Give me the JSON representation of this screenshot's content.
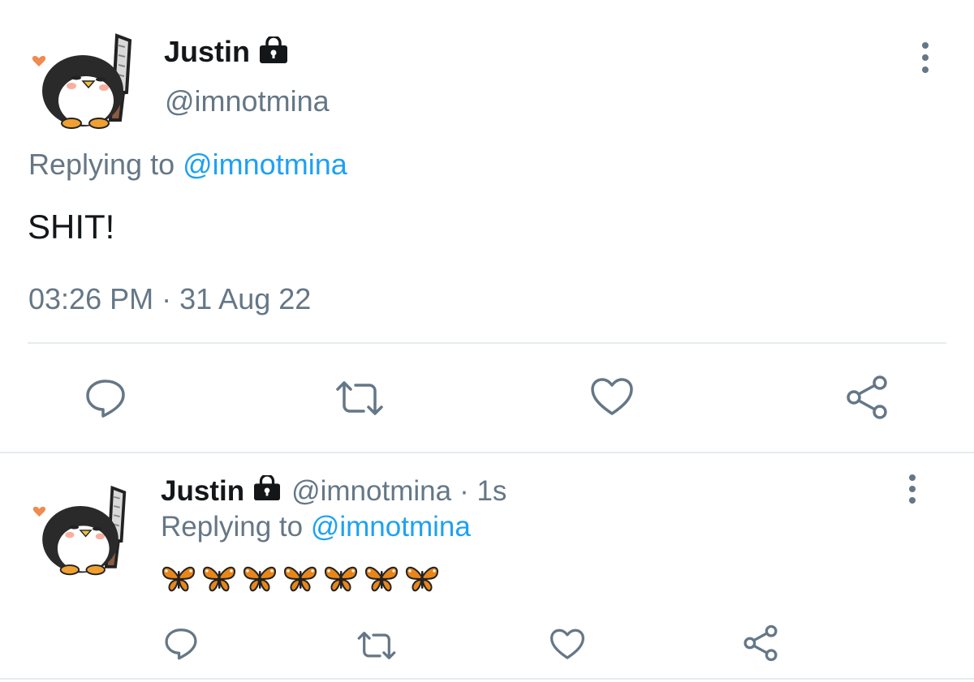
{
  "main_tweet": {
    "display_name": "Justin",
    "handle": "@imnotmina",
    "replying_prefix": "Replying to",
    "replying_to": "@imnotmina",
    "text": "SHIT!",
    "time": "03:26 PM",
    "separator": "·",
    "date": "31 Aug 22",
    "actions": [
      "reply-icon",
      "retweet-icon",
      "like-icon",
      "share-icon"
    ]
  },
  "reply_tweet": {
    "display_name": "Justin",
    "handle": "@imnotmina",
    "age": "· 1s",
    "replying_prefix": "Replying to",
    "replying_to": "@imnotmina",
    "emoji_text": "🦋🦋🦋🦋🦋🦋🦋",
    "actions": [
      "reply-icon",
      "retweet-icon",
      "like-icon",
      "share-icon"
    ]
  },
  "colors": {
    "link_blue": "#1da1f2",
    "muted_grey": "#657786",
    "text": "#14171a",
    "divider": "#e6ecf0",
    "butterfly_orange": "#e8861a"
  }
}
